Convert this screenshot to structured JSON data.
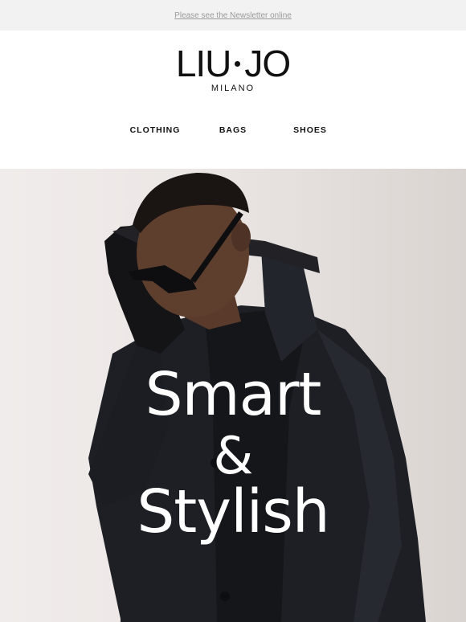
{
  "preheader": {
    "link_text": "Please see the Newsletter online"
  },
  "brand": {
    "name_left": "LIU",
    "name_right": "JO",
    "tagline": "MILANO"
  },
  "nav": {
    "items": [
      "CLOTHING",
      "BAGS",
      "SHOES"
    ]
  },
  "hero": {
    "image_description_icon": "man-in-black-jacket-photo",
    "headline_line1": "Smart",
    "headline_line2": "&",
    "headline_line3": "Stylish"
  },
  "colors": {
    "background": "#ffffff",
    "preheader_bg": "#f2f2f2",
    "text": "#111111",
    "headline": "#ffffff"
  }
}
